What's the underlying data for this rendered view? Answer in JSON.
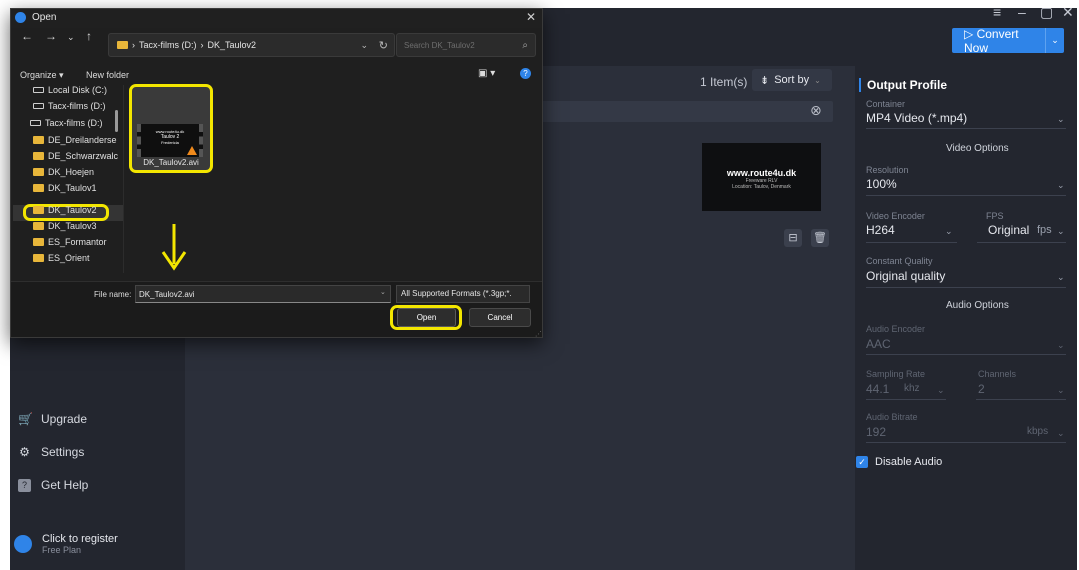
{
  "dialog": {
    "title": "Open",
    "path_drive": "Tacx-films (D:)",
    "path_folder": "DK_Taulov2",
    "search_placeholder": "Search DK_Taulov2",
    "organize": "Organize",
    "new_folder": "New folder",
    "tree": [
      {
        "label": "Local Disk (C:)",
        "kind": "drive"
      },
      {
        "label": "Tacx-films (D:)",
        "kind": "drive"
      },
      {
        "label": "Tacx-films (D:)",
        "kind": "drive"
      },
      {
        "label": "DE_Dreilanderse",
        "kind": "folder"
      },
      {
        "label": "DE_Schwarzwalc",
        "kind": "folder"
      },
      {
        "label": "DK_Hoejen",
        "kind": "folder"
      },
      {
        "label": "DK_Taulov1",
        "kind": "folder"
      },
      {
        "label": "DK_Taulov2",
        "kind": "folder"
      },
      {
        "label": "DK_Taulov3",
        "kind": "folder"
      },
      {
        "label": "ES_Formantor",
        "kind": "folder"
      },
      {
        "label": "ES_Orient",
        "kind": "folder"
      }
    ],
    "file": {
      "name": "DK_Taulov2.avi",
      "thumb_line1": "www.route4u.dk",
      "thumb_line2": "Taulov 2",
      "thumb_line3": "Fredericia"
    },
    "file_name_label": "File name:",
    "file_name_value": "DK_Taulov2.avi",
    "filter": "All Supported Formats (*.3gp;*.",
    "open_label": "Open",
    "cancel_label": "Cancel"
  },
  "app": {
    "items_count": "1 Item(s)",
    "sort_by": "Sort by",
    "convert_now": "Convert Now",
    "video_thumb_line1": "www.route4u.dk",
    "video_thumb_line2": "Freeware RLV",
    "video_thumb_line3": "Location: Taulov, Denmark",
    "sidebar": {
      "upgrade": "Upgrade",
      "settings": "Settings",
      "get_help": "Get Help",
      "register": "Click to register",
      "plan": "Free Plan"
    },
    "profile": {
      "title": "Output Profile",
      "container_label": "Container",
      "container_value": "MP4 Video (*.mp4)",
      "video_options": "Video Options",
      "resolution_label": "Resolution",
      "resolution_value": "100%",
      "encoder_label": "Video Encoder",
      "encoder_value": "H264",
      "fps_label": "FPS",
      "fps_value": "Original",
      "fps_unit": "fps",
      "quality_label": "Constant Quality",
      "quality_value": "Original quality",
      "audio_options": "Audio Options",
      "audio_encoder_label": "Audio Encoder",
      "audio_encoder_value": "AAC",
      "sampling_label": "Sampling Rate",
      "sampling_value": "44.1",
      "sampling_unit": "khz",
      "channels_label": "Channels",
      "channels_value": "2",
      "bitrate_label": "Audio Bitrate",
      "bitrate_value": "192",
      "bitrate_unit": "kbps",
      "disable_audio": "Disable Audio"
    }
  },
  "colors": {
    "accent": "#2f84e8",
    "highlight": "#f3e600"
  }
}
